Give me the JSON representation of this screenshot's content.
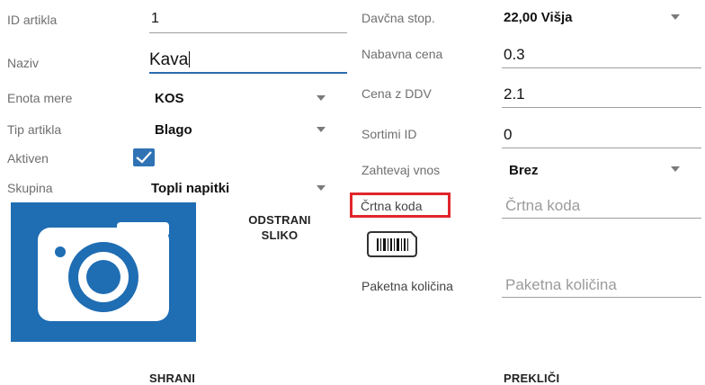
{
  "left": {
    "id": {
      "label": "ID artikla",
      "value": "1"
    },
    "name": {
      "label": "Naziv",
      "value": "Kava"
    },
    "unit": {
      "label": "Enota mere",
      "value": "KOS"
    },
    "type": {
      "label": "Tip artikla",
      "value": "Blago"
    },
    "active": {
      "label": "Aktiven",
      "checked": true
    },
    "group": {
      "label": "Skupina",
      "value": "Topli napitki"
    },
    "remove_image": "ODSTRANI\nSLIKO"
  },
  "right": {
    "tax": {
      "label": "Davčna stop.",
      "value": "22,00 Višja"
    },
    "purchase_price": {
      "label": "Nabavna cena",
      "value": "0.3"
    },
    "price_vat": {
      "label": "Cena z DDV",
      "value": "2.1"
    },
    "sort_id": {
      "label": "Sortimi ID",
      "value": "0"
    },
    "require_input": {
      "label": "Zahtevaj vnos",
      "value": "Brez"
    },
    "barcode": {
      "label": "Črtna koda",
      "placeholder": "Črtna koda"
    },
    "package_qty": {
      "label": "Paketna količina",
      "placeholder": "Paketna količina"
    }
  },
  "footer": {
    "save": "SHRANI",
    "cancel": "PREKLIČI"
  },
  "colors": {
    "accent": "#2f73b5",
    "photo_bg": "#1f6db3",
    "highlight": "#e0262b"
  },
  "icons": {
    "photo": "camera-icon",
    "barcode": "barcode-icon",
    "dropdown": "chevron-down-icon",
    "check": "checkmark-icon"
  }
}
